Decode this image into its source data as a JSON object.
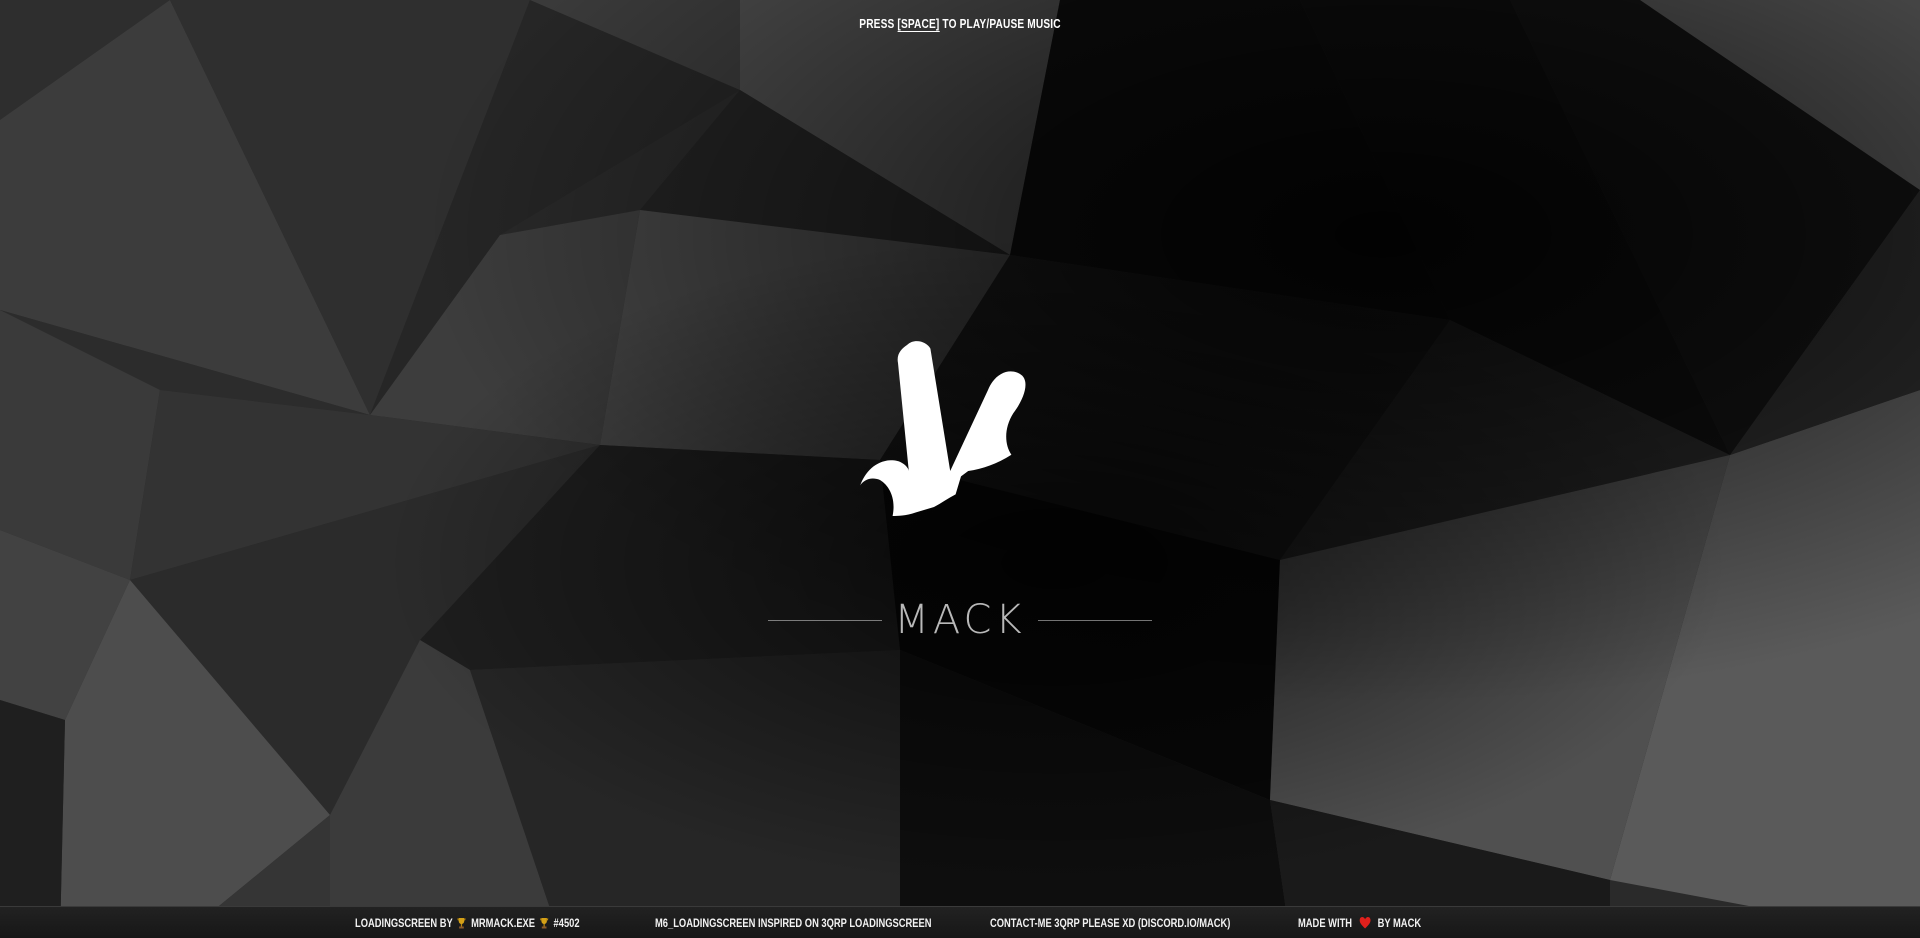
{
  "top_hint": {
    "prefix": "PRESS ",
    "key": "[SPACE]",
    "suffix": " TO PLAY/PAUSE MUSIC"
  },
  "brand": {
    "name": "MACK"
  },
  "footer": {
    "credit_prefix": "LOADINGSCREEN BY",
    "credit_user": "MRMACK.EXE",
    "credit_tag": "#4502",
    "inspired_text": "M6_LOADINGSCREEN INSPIRED ON 3QRP LOADINGSCREEN",
    "contact_text": "CONTACT-ME 3QRP PLEASE XD (DISCORD.IO/MACK)",
    "made_with_prefix": "MADE WITH",
    "made_with_suffix": "BY MACK"
  },
  "colors": {
    "background_dark": "#0a0a0a",
    "background_light": "#555555",
    "logo": "#ffffff",
    "heart": "#e0201c",
    "trophy": "#d4a017"
  },
  "icons": {
    "credit_left": "trophy-icon",
    "credit_right": "trophy-icon",
    "made_with": "heart-icon"
  }
}
